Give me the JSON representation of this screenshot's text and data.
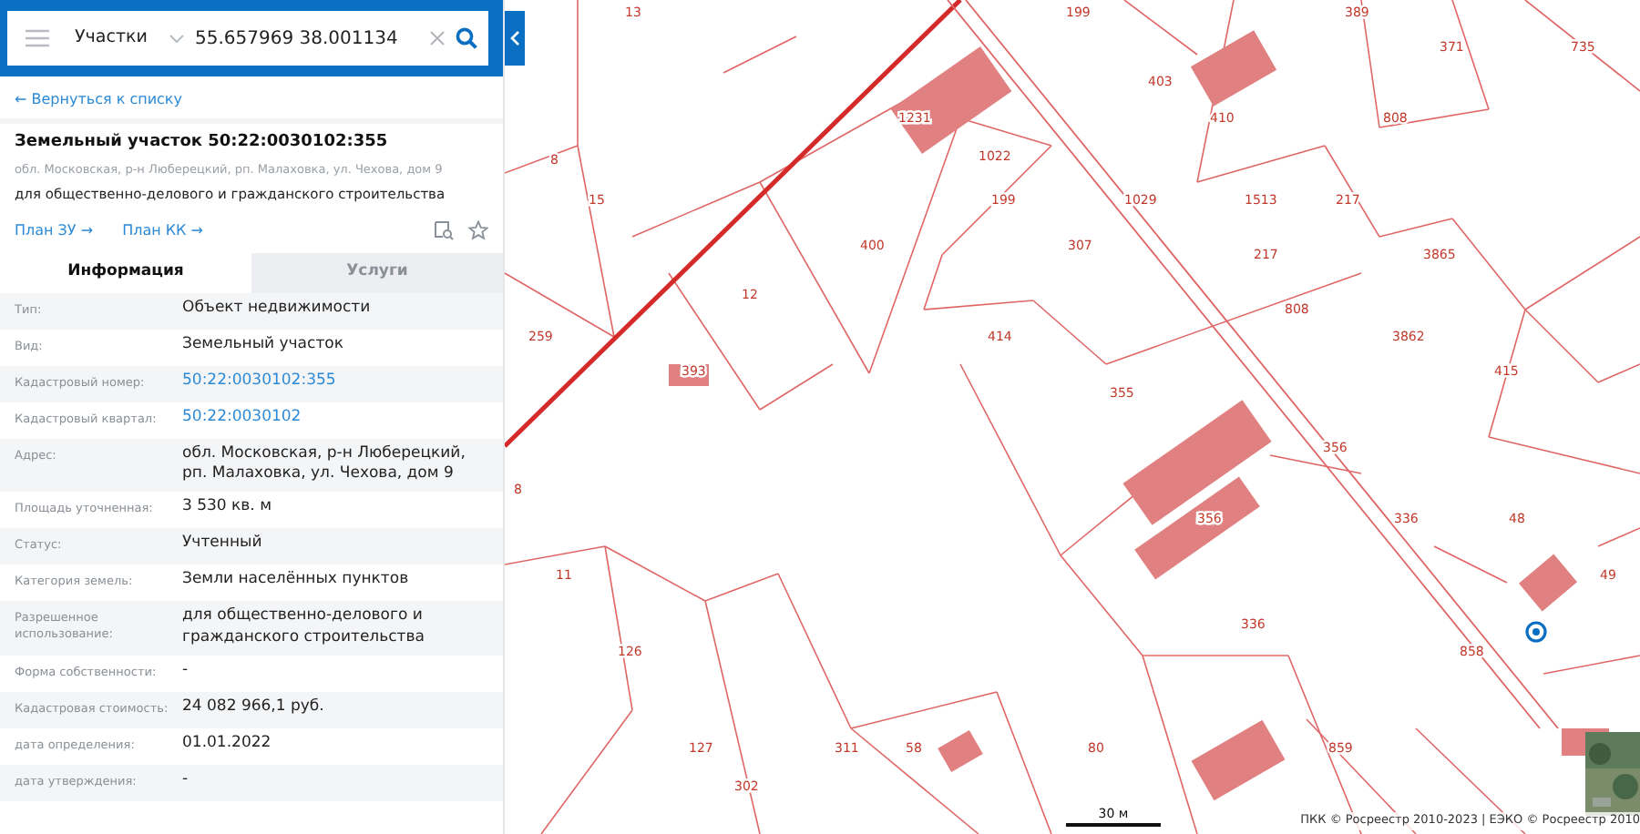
{
  "search": {
    "layer": "Участки",
    "value": "55.657969 38.001134"
  },
  "back_link": "← Вернуться к списку",
  "parcel": {
    "title": "Земельный участок 50:22:0030102:355",
    "address": "обл. Московская, р-н Люберецкий, рп. Малаховка, ул. Чехова, дом 9",
    "purpose": "для общественно-делового и гражданского строительства",
    "links": [
      "План ЗУ →",
      "План КК →"
    ]
  },
  "tabs": [
    {
      "label": "Информация",
      "selected": true
    },
    {
      "label": "Услуги",
      "selected": false
    }
  ],
  "properties": [
    {
      "label": "Тип:",
      "value": "Объект недвижимости",
      "kind": "text"
    },
    {
      "label": "Вид:",
      "value": "Земельный участок",
      "kind": "text"
    },
    {
      "label": "Кадастровый номер:",
      "value": "50:22:0030102:355",
      "kind": "link"
    },
    {
      "label": "Кадастровый квартал:",
      "value": "50:22:0030102",
      "kind": "link"
    },
    {
      "label": "Адрес:",
      "value": "обл. Московская, р-н Люберецкий, рп. Малаховка, ул. Чехова, дом 9",
      "kind": "text"
    },
    {
      "label": "Площадь уточненная:",
      "value": "3 530 кв. м",
      "kind": "text"
    },
    {
      "label": "Статус:",
      "value": "Учтенный",
      "kind": "text"
    },
    {
      "label": "Категория земель:",
      "value": "Земли населённых пунктов",
      "kind": "text"
    },
    {
      "label": "Разрешенное использование:",
      "value": "для общественно-делового и гражданского строительства",
      "kind": "text"
    },
    {
      "label": "Форма собственности:",
      "value": "-",
      "kind": "text"
    },
    {
      "label": "Кадастровая стоимость:",
      "value": "24 082 966,1 руб.",
      "kind": "text"
    },
    {
      "label": "дата определения:",
      "value": "01.01.2022",
      "kind": "text"
    },
    {
      "label": "дата утверждения:",
      "value": "-",
      "kind": "text"
    }
  ],
  "map": {
    "parcel_labels": [
      "13",
      "199",
      "389",
      "371",
      "735",
      "403",
      "1231",
      "410",
      "808",
      "8",
      "1022",
      "15",
      "199",
      "1029",
      "1513",
      "217",
      "400",
      "307",
      "217",
      "3865",
      "12",
      "808",
      "259",
      "414",
      "3862",
      "393",
      "415",
      "355",
      "356",
      "8",
      "356",
      "336",
      "48",
      "11",
      "49",
      "336",
      "126",
      "858",
      "127",
      "311",
      "58",
      "80",
      "859",
      "302"
    ],
    "scale": "30 м",
    "attribution": "ПКК © Росреестр 2010-2023 | ЕЭКО © Росреестр 2010"
  }
}
